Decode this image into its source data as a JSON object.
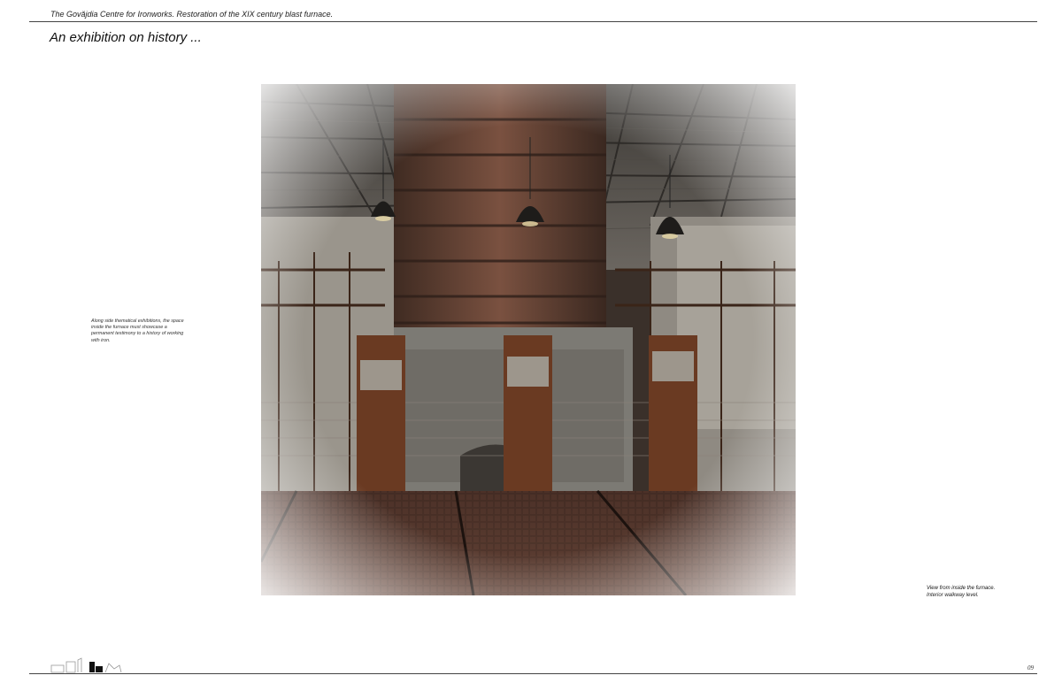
{
  "header": {
    "running_title": "The Govăjdia Centre for Ironworks. Restoration of the XIX century blast furnace."
  },
  "page": {
    "title": "An exhibition on history ...",
    "number": "09"
  },
  "captions": {
    "left": "Along side thematical exhibitions, the space inside the furnace must showcase a permanent testimony to a history of working with iron.",
    "right_line1": "View from inside the furnace.",
    "right_line2": "Interior walkway level."
  },
  "render": {
    "subject": "furnace-interior-render",
    "palette": {
      "roof": "#5c5853",
      "brick": "#6e4a3a",
      "stone": "#8a8780",
      "floor": "#4a3026",
      "corten": "#6a3a22"
    }
  },
  "footer": {
    "thumbnails_icon": "site-thumbnail-strip"
  }
}
